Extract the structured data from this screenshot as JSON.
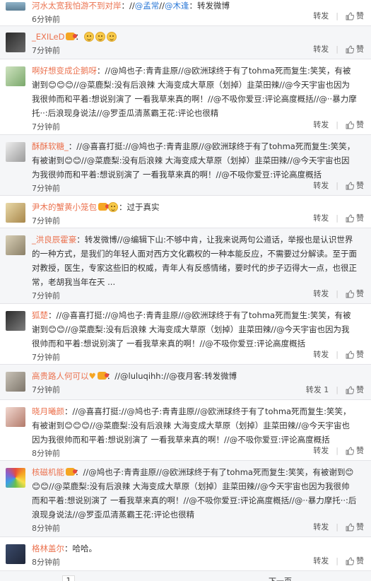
{
  "items": [
    {
      "id": "i0",
      "name": "河水太宽我怕游不到对岸",
      "segments": [
        {
          "t": "：//",
          "c": "text"
        },
        {
          "t": "@孟常",
          "c": "link"
        },
        {
          "t": "//",
          "c": "text"
        },
        {
          "t": "@木逢",
          "c": "link"
        },
        {
          "t": "：转发微博",
          "c": "text"
        }
      ],
      "time": "6分钟前",
      "repost": "转发",
      "like_label": "赞"
    },
    {
      "id": "i1",
      "name": "_EXILeD",
      "segments": [
        {
          "t": "：",
          "c": "text"
        }
      ],
      "emojis_after_name": 3,
      "time": "7分钟前",
      "repost": "转发",
      "like_label": "赞"
    },
    {
      "id": "i2",
      "name": "啊好想变成企鹅呀",
      "text": "：//@鸠也子:青青韭原//@欧洲球终于有了tohma死而复生:笑笑，有被谢到😊😊😊//@菜鹿梨:没有后浪辣 大海变成大草原（划掉）韭菜田辣//@今天宇宙也因为我很帅而和平着:想说别演了 一看我草来真的啊！//@不吸你爱豆:评论高度概括//@··暴力摩托··:后浪现身说法//@罗歪瓜清蒸霸王花:评论也很精",
      "time": "7分钟前",
      "repost": "转发",
      "like_label": "赞"
    },
    {
      "id": "i3",
      "name": "酥酥软糖_",
      "text": "：//@喜喜打挺://@鸠也子:青青韭原//@欧洲球终于有了tohma死而复生:笑笑，有被谢到😊😊//@菜鹿梨:没有后浪辣 大海变成大草原（划掉）韭菜田辣//@今天宇宙也因为我很帅而和平着:想说别演了 一看我草来真的啊！//@不吸你爱豆:评论高度概括",
      "time": "7分钟前",
      "repost": "转发",
      "like_label": "赞"
    },
    {
      "id": "i4",
      "name": "尹木的蟹黄小笼包",
      "text": "：过于真实",
      "time": "7分钟前",
      "repost": "转发",
      "like_label": "赞"
    },
    {
      "id": "i5",
      "name": "_洪良辰霍豪",
      "text": "：转发微博//@编辑下山:不够中肯，让我来说两句公道话，举报也是认识世界的一种方式，是我们的年轻人面对西方文化霸权的一种本能反应，不需要过分解读。至于面对教授，医生，专家这些旧的权威，青年人有反感情绪，要时代的步子迈得大一点，也很正常，老胡我当年在天 ...",
      "time": "7分钟前",
      "repost": "转发",
      "like_label": "赞"
    },
    {
      "id": "i6",
      "name": "狐楚",
      "text": "：//@喜喜打挺://@鸠也子:青青韭原//@欧洲球终于有了tohma死而复生:笑笑，有被谢到😊😊//@菜鹿梨:没有后浪辣 大海变成大草原（划掉）韭菜田辣//@今天宇宙也因为我很帅而和平着:想说别演了 一看我草来真的啊！//@不吸你爱豆:评论高度概括",
      "time": "7分钟前",
      "repost": "转发",
      "like_label": "赞"
    },
    {
      "id": "i7",
      "name": "高贵路人何可以",
      "text": "：//@luluqihh://@夜月客:转发微博",
      "time": "7分钟前",
      "repost": "转发 1",
      "like_label": "赞"
    },
    {
      "id": "i8",
      "name": "晓月曦颜",
      "text": "：//@喜喜打挺://@鸠也子:青青韭原//@欧洲球终于有了tohma死而复生:笑笑，有被谢到😊😊😊//@菜鹿梨:没有后浪辣 大海变成大草原（划掉）韭菜田辣//@今天宇宙也因为我很帅而和平着:想说别演了 一看我草来真的啊！//@不吸你爱豆:评论高度概括",
      "time": "8分钟前",
      "repost": "转发",
      "like_label": "赞"
    },
    {
      "id": "i9",
      "name": "核磁机能",
      "text": "：//@鸠也子:青青韭原//@欧洲球终于有了tohma死而复生:笑笑，有被谢到😊😊😊//@菜鹿梨:没有后浪辣 大海变成大草原（划掉）韭菜田辣//@今天宇宙也因为我很帅而和平着:想说别演了 一看我草来真的啊！//@不吸你爱豆:评论高度概括//@··暴力摩托··:后浪现身说法//@罗歪瓜清蒸霸王花:评论也很精",
      "time": "8分钟前",
      "repost": "转发",
      "like_label": "赞"
    },
    {
      "id": "i10",
      "name": "格林盖尔",
      "text": "：哈哈。",
      "time": "8分钟前",
      "repost": "转发",
      "like_label": "赞"
    }
  ],
  "pager": {
    "current": "1",
    "next": "下一页"
  }
}
